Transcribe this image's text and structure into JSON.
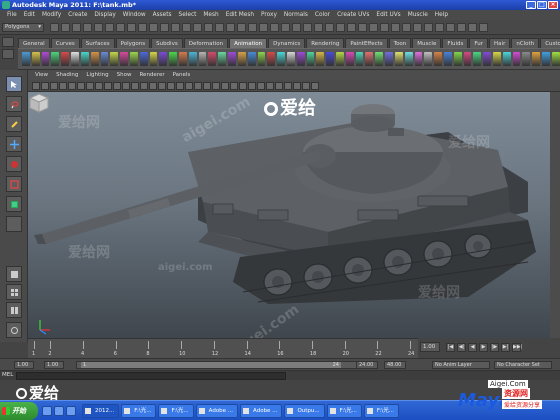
{
  "window": {
    "title": "Autodesk Maya 2011: F:\\tank.mb*",
    "controls": [
      "_",
      "□",
      "×"
    ]
  },
  "menubar": {
    "items": [
      "File",
      "Edit",
      "Modify",
      "Create",
      "Display",
      "Window",
      "Assets",
      "Select",
      "Mesh",
      "Edit Mesh",
      "Proxy",
      "Normals",
      "Color",
      "Create UVs",
      "Edit UVs",
      "Muscle",
      "Help"
    ]
  },
  "statusline": {
    "mode": "Polygons"
  },
  "shelf": {
    "tabs": [
      "General",
      "Curves",
      "Surfaces",
      "Polygons",
      "Subdivs",
      "Deformation",
      "Animation",
      "Dynamics",
      "Rendering",
      "PaintEffects",
      "Toon",
      "Muscle",
      "Fluids",
      "Fur",
      "Hair",
      "nCloth",
      "Custom"
    ],
    "active_tab": "Animation",
    "icon_colors": [
      "#4a9bd6",
      "#d6c24a",
      "#b04ad6",
      "#4ad67a",
      "#d64a4a",
      "#e0e0e0",
      "#4ad6c8",
      "#d6914a",
      "#6a8ad6",
      "#c2d64a",
      "#d64a9b",
      "#9bd64a",
      "#4a6ad6",
      "#d6d64a",
      "#7a4ad6",
      "#4ad64a",
      "#d67a4a",
      "#4ab6d6",
      "#b6b6b6",
      "#d64a6a",
      "#6ad6a0",
      "#a04ad6",
      "#d6a04a",
      "#4a8ad6",
      "#8ad64a",
      "#d64a4a",
      "#4ad6d6",
      "#d6d6d6",
      "#9b4ad6",
      "#4ad69b",
      "#d6b64a",
      "#4a4ad6",
      "#b6d64a",
      "#d64ab6",
      "#4ad6b6",
      "#e07070",
      "#70e070",
      "#7070e0",
      "#e0e070",
      "#70e0e0",
      "#e070e0",
      "#c0c0c0",
      "#d6824a",
      "#4a82d6",
      "#82d64a",
      "#d64a82",
      "#4ad682",
      "#824ad6",
      "#d6d64a",
      "#4ad6d6",
      "#d64ad6",
      "#8a8a8a",
      "#e0a040",
      "#40a0e0",
      "#a0e040"
    ]
  },
  "panel": {
    "menu": [
      "View",
      "Shading",
      "Lighting",
      "Show",
      "Renderer",
      "Panels"
    ]
  },
  "timeline": {
    "ticks": [
      1,
      2,
      4,
      6,
      8,
      10,
      12,
      14,
      16,
      18,
      20,
      22,
      24
    ],
    "current_frame": "1.00",
    "playback_buttons": [
      "|◀",
      "◀|",
      "◀",
      "▶",
      "|▶",
      "▶|",
      "▶▶|"
    ]
  },
  "range": {
    "start": "1.00",
    "start_inner": "1.00",
    "slider_label": "1",
    "end_inner": "24",
    "end_current": "24.00",
    "end": "48.00",
    "anim_layer": "No Anim Layer",
    "character_set": "No Character Set"
  },
  "commandline": {
    "label": "MEL"
  },
  "taskbar": {
    "start_label": "开始",
    "items": [
      "2012...",
      "F:\\光...",
      "F:\\光...",
      "Adobe ...",
      "Adobe ...",
      "Outpu...",
      "F:\\光...",
      "F:\\光..."
    ]
  },
  "watermark": {
    "logo_text": "爱给",
    "site_text": "爱给网",
    "domain_text": "aigei.com",
    "brand_domain": "Aigei.Com",
    "brand_maya": "Maya",
    "brand_res": "资源网",
    "brand_res_url": "爱给资源分享"
  },
  "colors": {
    "title_bar": "#2d59d6",
    "maya_ui": "#4a4a4a",
    "viewport_top": "#7f8c98",
    "viewport_bottom": "#3f464d",
    "taskbar": "#245edb",
    "start_button": "#3a9e3a"
  }
}
